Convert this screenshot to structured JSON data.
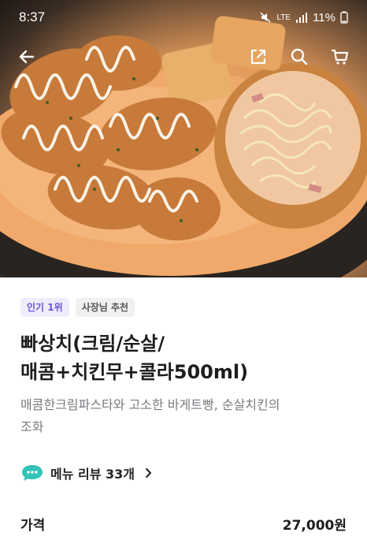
{
  "status_bar": {
    "time": "8:37",
    "battery": "11%",
    "network": "LTE"
  },
  "nav": {
    "back_icon": "arrow-left-icon",
    "share_icon": "share-icon",
    "search_icon": "search-icon",
    "cart_icon": "cart-icon"
  },
  "product": {
    "badges": [
      "인기 1위",
      "사장님 추천"
    ],
    "title_line1": "빠상치(크림/순살/",
    "title_line2": "매콤+치킨무+콜라500ml)",
    "description_line1": "매콤한크림파스타와 고소한 바게트빵, 순살치킨의",
    "description_line2": "조화",
    "review_label": "메뉴 리뷰 33개",
    "price_label": "가격",
    "price_value": "27,000원"
  },
  "colors": {
    "accent": "#6a56d8",
    "review_icon": "#33c3b8"
  }
}
